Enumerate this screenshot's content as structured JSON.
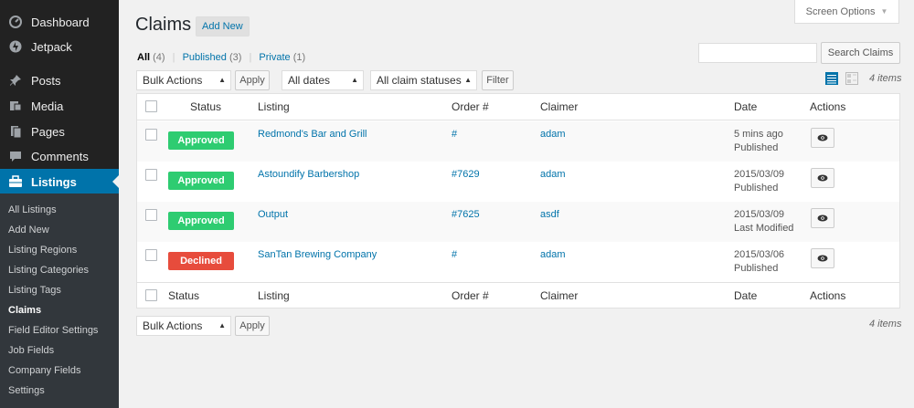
{
  "sidebar": {
    "items": [
      {
        "label": "Dashboard",
        "icon": "dashboard-icon"
      },
      {
        "label": "Jetpack",
        "icon": "jetpack-icon"
      },
      {
        "label": "Posts",
        "icon": "pin-icon"
      },
      {
        "label": "Media",
        "icon": "media-icon"
      },
      {
        "label": "Pages",
        "icon": "pages-icon"
      },
      {
        "label": "Comments",
        "icon": "comment-icon"
      },
      {
        "label": "Listings",
        "icon": "briefcase-icon"
      }
    ],
    "submenu": [
      "All Listings",
      "Add New",
      "Listing Regions",
      "Listing Categories",
      "Listing Tags",
      "Claims",
      "Field Editor Settings",
      "Job Fields",
      "Company Fields",
      "Settings"
    ],
    "active_color": "#0073aa"
  },
  "header": {
    "title": "Claims",
    "add_new": "Add New",
    "screen_options": "Screen Options"
  },
  "filters": {
    "all": "All",
    "all_count": "(4)",
    "published": "Published",
    "published_count": "(3)",
    "private": "Private",
    "private_count": "(1)",
    "separator": "|"
  },
  "search": {
    "button": "Search Claims",
    "value": ""
  },
  "tablenav": {
    "bulk_actions": "Bulk Actions",
    "apply": "Apply",
    "all_dates": "All dates",
    "all_statuses": "All claim statuses",
    "filter": "Filter",
    "items_count": "4 items"
  },
  "table": {
    "columns": [
      "Status",
      "Listing",
      "Order #",
      "Claimer",
      "Date",
      "Actions"
    ],
    "rows": [
      {
        "status": "Approved",
        "status_color": "#2ecc71",
        "listing": "Redmond's Bar and Grill",
        "order": "#",
        "claimer": "adam",
        "date": "5 mins ago",
        "date_status": "Published"
      },
      {
        "status": "Approved",
        "status_color": "#2ecc71",
        "listing": "Astoundify Barbershop",
        "order": "#7629",
        "claimer": "adam",
        "date": "2015/03/09",
        "date_status": "Published"
      },
      {
        "status": "Approved",
        "status_color": "#2ecc71",
        "listing": "Output",
        "order": "#7625",
        "claimer": "asdf",
        "date": "2015/03/09",
        "date_status": "Last Modified"
      },
      {
        "status": "Declined",
        "status_color": "#e74c3c",
        "listing": "SanTan Brewing Company",
        "order": "#",
        "claimer": "adam",
        "date": "2015/03/06",
        "date_status": "Published"
      }
    ],
    "action_icon": "eye-icon"
  }
}
